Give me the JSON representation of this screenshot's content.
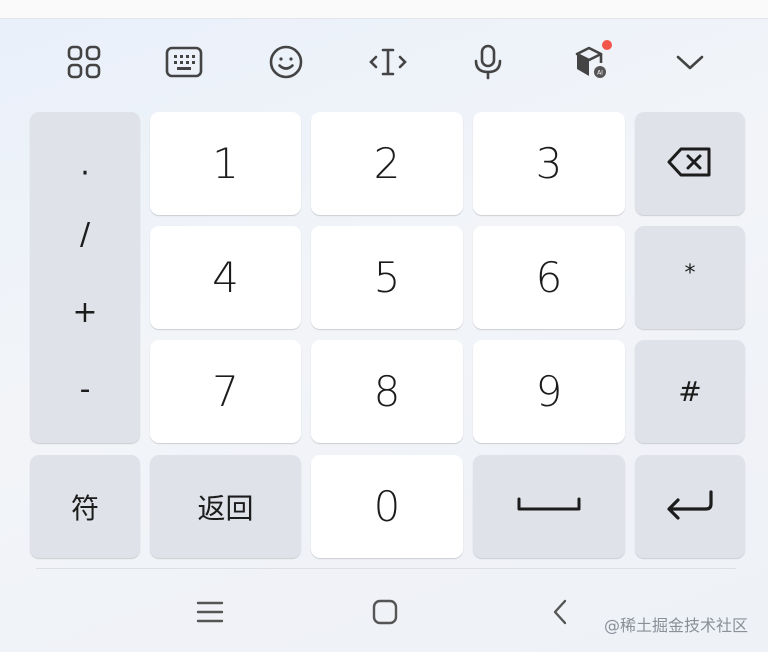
{
  "toolbar": {
    "icons": [
      "apps-grid-icon",
      "keyboard-icon",
      "emoji-icon",
      "text-cursor-icon",
      "microphone-icon",
      "ai-box-icon",
      "chevron-down-icon"
    ],
    "notification_color": "#f4554a"
  },
  "keypad": {
    "left_column": [
      "·",
      "/",
      "+",
      "-"
    ],
    "digits": [
      "1",
      "2",
      "3",
      "4",
      "5",
      "6",
      "7",
      "8",
      "9",
      "0"
    ],
    "right_column": [
      "*",
      "#"
    ],
    "symbols_label": "符",
    "back_label": "返回"
  },
  "navbar": {
    "icons": [
      "menu-icon",
      "home-icon",
      "back-icon"
    ]
  },
  "watermark": "@稀土掘金技术社区",
  "colors": {
    "key_white": "#ffffff",
    "key_gray": "#dfe2e8",
    "accent": "#f4554a"
  }
}
